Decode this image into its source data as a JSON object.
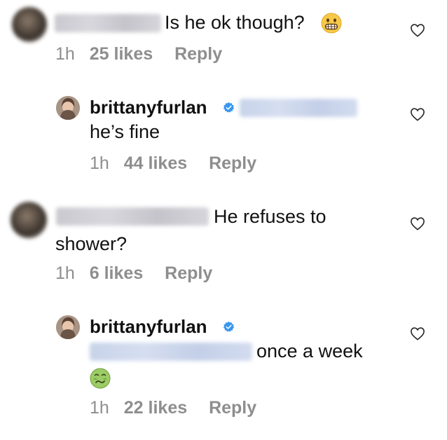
{
  "comments": [
    {
      "text": "Is he ok though?",
      "emoji": "grimacing-face",
      "time": "1h",
      "likes": "25 likes",
      "reply": "Reply"
    },
    {
      "username": "brittanyfurlan",
      "text": "he’s fine",
      "time": "1h",
      "likes": "44 likes",
      "reply": "Reply"
    },
    {
      "text_line1": "He refuses to",
      "text_line2": "shower?",
      "time": "1h",
      "likes": "6 likes",
      "reply": "Reply"
    },
    {
      "username": "brittanyfurlan",
      "text": "once a week",
      "emoji": "nauseated-face",
      "time": "1h",
      "likes": "22 likes",
      "reply": "Reply"
    }
  ],
  "colors": {
    "meta_gray": "#8e8e8e",
    "verified_blue": "#3897f0",
    "text": "#111111"
  }
}
